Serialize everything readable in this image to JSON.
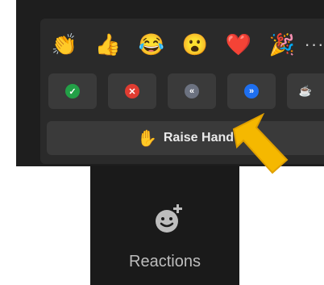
{
  "reactions_popup": {
    "emojis": [
      {
        "name": "clap",
        "glyph": "👏"
      },
      {
        "name": "thumbs-up",
        "glyph": "👍"
      },
      {
        "name": "tears-of-joy",
        "glyph": "😂"
      },
      {
        "name": "open-mouth",
        "glyph": "😮"
      },
      {
        "name": "heart",
        "glyph": "❤️"
      },
      {
        "name": "party-popper",
        "glyph": "🎉"
      }
    ],
    "more_label": "···",
    "status_buttons": [
      {
        "name": "yes",
        "symbol": "✓",
        "color": "#23a047"
      },
      {
        "name": "no",
        "symbol": "✕",
        "color": "#e03c31"
      },
      {
        "name": "slow-down",
        "symbol": "«",
        "color": "#6c7280"
      },
      {
        "name": "speed-up",
        "symbol": "»",
        "color": "#1e6ff0"
      },
      {
        "name": "coffee",
        "symbol": "☕",
        "color": "#3a3a3a"
      }
    ],
    "raise_hand": {
      "icon": "✋",
      "label": "Raise Hand"
    }
  },
  "toolbar": {
    "reactions_label": "Reactions",
    "reactions_icon": "smiley-plus-icon"
  },
  "colors": {
    "arrow": "#f5b800",
    "panel": "#2a2a2a",
    "button": "#3a3a3a"
  }
}
